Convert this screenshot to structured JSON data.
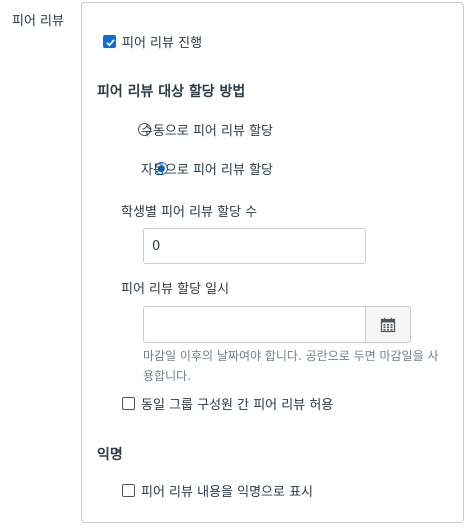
{
  "row_label": "피어 리뷰",
  "enable_peer_review": {
    "label": "피어 리뷰 진행",
    "checked": true
  },
  "assignment": {
    "heading": "피어 리뷰 대상 할당 방법",
    "options": [
      {
        "label": "수동으로 피어 리뷰 할당",
        "selected": false
      },
      {
        "label": "자동으로 피어 리뷰 할당",
        "selected": true
      }
    ],
    "count_label": "학생별 피어 리뷰 할당 수",
    "count_value": "0",
    "date_label": "피어 리뷰 할당 일시",
    "date_value": "",
    "date_hint_line1": "마감일 이후의 날짜여야 합니다. 공란으로 두면 마감일을 사",
    "date_hint_line2": "용합니다.",
    "same_group": {
      "label": "동일 그룹 구성원 간 피어 리뷰 허용",
      "checked": false
    }
  },
  "anonymity": {
    "heading": "익명",
    "anonymous": {
      "label": "피어 리뷰 내용을 익명으로 표시",
      "checked": false
    }
  },
  "colors": {
    "accent": "#0b6fd8",
    "border": "#c7cdd1",
    "text": "#2d3b45",
    "hint": "#73818b"
  }
}
